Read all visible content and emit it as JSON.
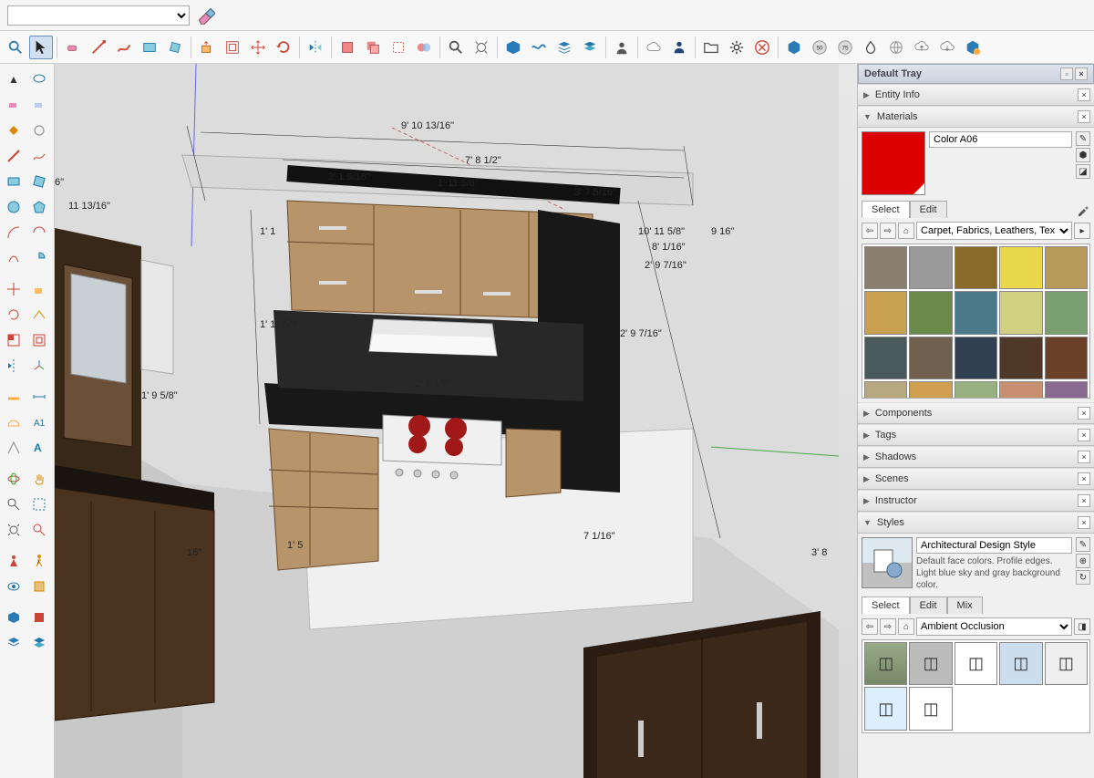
{
  "tray": {
    "title": "Default Tray",
    "panels": {
      "entity_info": "Entity Info",
      "materials": "Materials",
      "components": "Components",
      "tags": "Tags",
      "shadows": "Shadows",
      "scenes": "Scenes",
      "instructor": "Instructor",
      "styles": "Styles"
    }
  },
  "materials": {
    "name": "Color A06",
    "tabs": {
      "select": "Select",
      "edit": "Edit"
    },
    "collection": "Carpet, Fabrics, Leathers, Tex",
    "swatches": [
      "#8a7f6e",
      "#9a9a9a",
      "#8a6a2a",
      "#e8d84a",
      "#b89a5a",
      "#c8a050",
      "#6a8a4a",
      "#4a7a8a",
      "#d0d080",
      "#7aa070",
      "#4a5a5a",
      "#706050",
      "#304050",
      "#503828",
      "#6a4028",
      "#b8a880",
      "#d0a050",
      "#98b080",
      "#c89070",
      "#8a6a90"
    ]
  },
  "styles": {
    "name": "Architectural Design Style",
    "desc": "Default face colors. Profile edges. Light blue sky and gray background color.",
    "tabs": {
      "select": "Select",
      "edit": "Edit",
      "mix": "Mix"
    },
    "collection": "Ambient Occlusion"
  },
  "dimensions": {
    "d1": "9' 10 13/16\"",
    "d2": "7' 8 1/2\"",
    "d3": "2' 1 9/16\"",
    "d4": "1' 11 5/8\"",
    "d5": "3' 7 5/16\"",
    "d6": "10' 11 5/8\"",
    "d6b": "9 16\"",
    "d7": "8' 1/16\"",
    "d8": "2' 9 7/16\"",
    "d9": "2' 9 7/16\"",
    "d10": "1' 11 5/8\"",
    "d11": "1' 1",
    "d12": "2' 7 1/8\"",
    "d13": "1' 9 5/8\"",
    "d14": "11 13/16\"",
    "d15": "7 1/16\"",
    "d16": "1' 5",
    "d17": "6\"",
    "d18": "3' 8",
    "d19": "16\""
  }
}
